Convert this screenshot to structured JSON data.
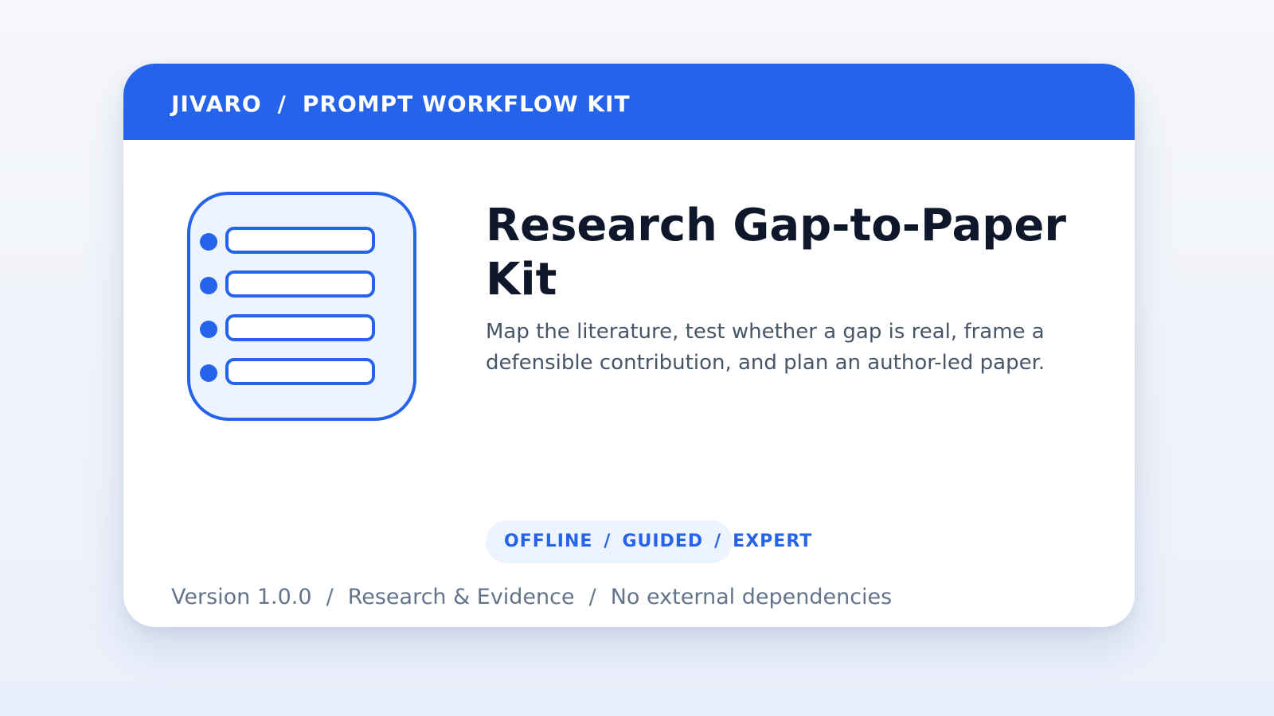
{
  "header": {
    "brand": "JIVARO",
    "separator": "/",
    "product": "PROMPT WORKFLOW KIT"
  },
  "product_icon": {
    "name": "checklist-icon",
    "rows": 4
  },
  "main": {
    "title": "Research Gap-to-Paper Kit",
    "description": "Map the literature, test whether a gap is real, frame a defensible contribution, and plan an author-led paper."
  },
  "tags": [
    "OFFLINE",
    "GUIDED",
    "EXPERT"
  ],
  "footer": {
    "version": "Version 1.0.0",
    "category": "Research & Evidence",
    "dependencies": "No external dependencies"
  },
  "colors": {
    "accent": "#2563eb",
    "title": "#0f172a",
    "body_text": "#475569",
    "muted_text": "#64748b",
    "icon_fill": "#eef4ff",
    "tag_background": "#eef4ff"
  }
}
